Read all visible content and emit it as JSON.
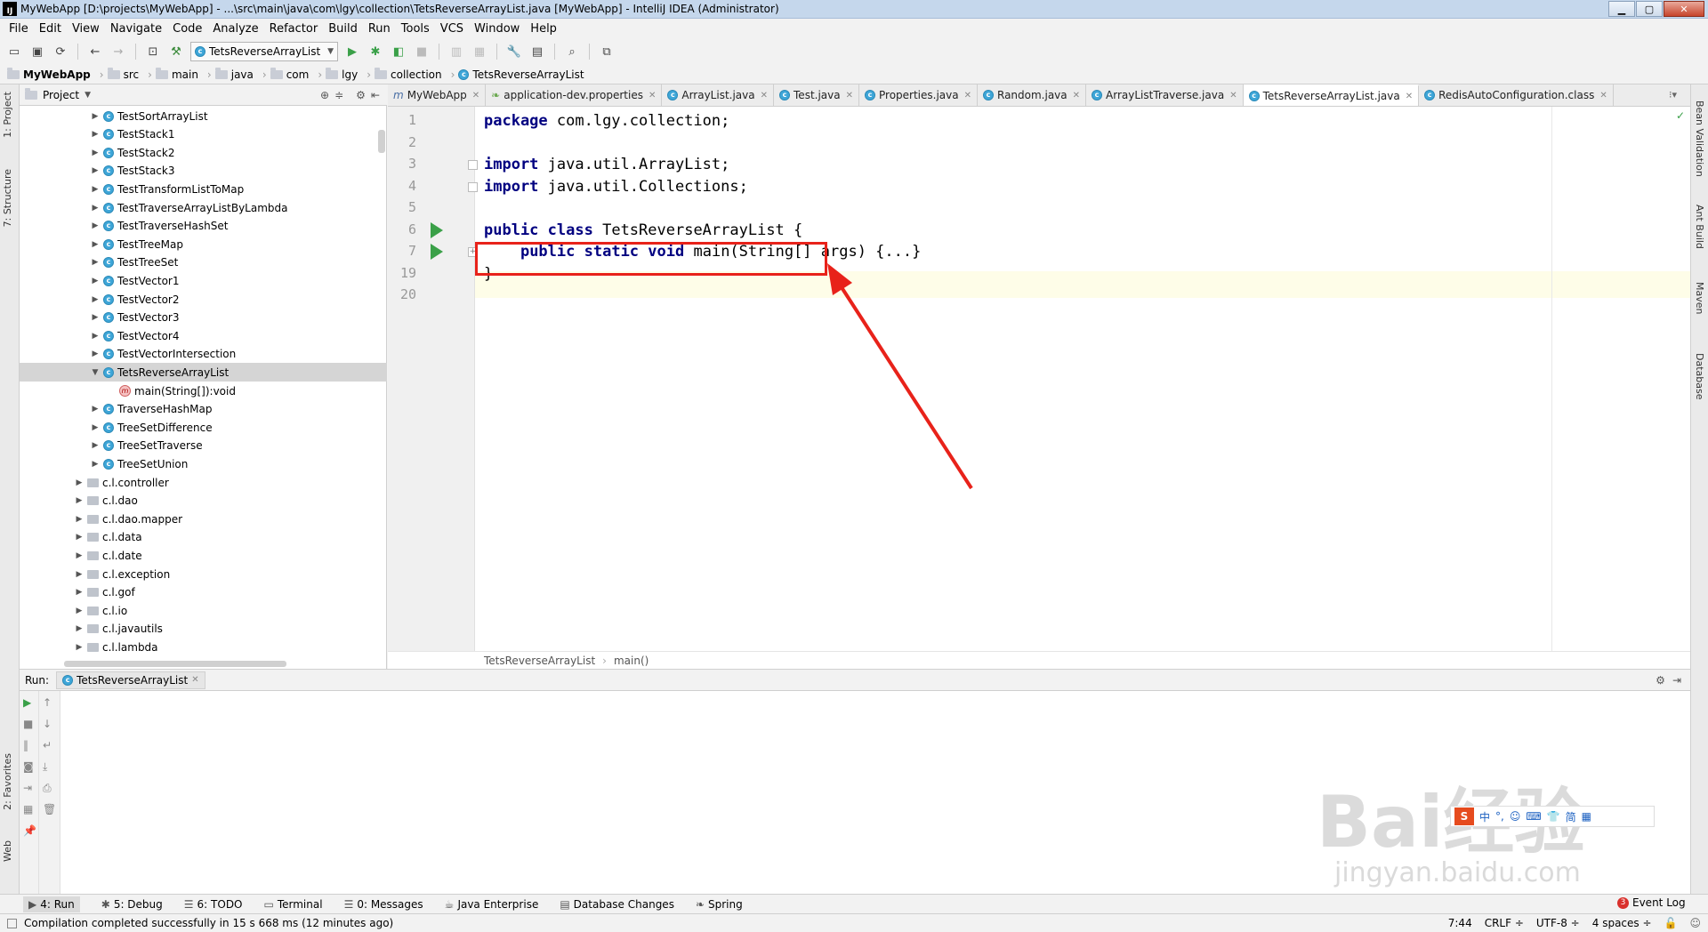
{
  "window": {
    "title": "MyWebApp [D:\\projects\\MyWebApp] - ...\\src\\main\\java\\com\\lgy\\collection\\TetsReverseArrayList.java [MyWebApp] - IntelliJ IDEA (Administrator)",
    "app_icon": "IJ"
  },
  "menu": [
    "File",
    "Edit",
    "View",
    "Navigate",
    "Code",
    "Analyze",
    "Refactor",
    "Build",
    "Run",
    "Tools",
    "VCS",
    "Window",
    "Help"
  ],
  "toolbar": {
    "run_config": "TetsReverseArrayList",
    "icons": [
      "open-icon",
      "save-icon",
      "sync-icon",
      "back-icon",
      "forward-icon",
      "project-structure-icon",
      "build-icon",
      "run-icon",
      "debug-icon",
      "coverage-icon",
      "stop-icon",
      "sdk-icon",
      "structure-icon",
      "settings-icon",
      "vcs-icon",
      "search-icon",
      "plugin-icon"
    ]
  },
  "navbar": {
    "crumbs": [
      "MyWebApp",
      "src",
      "main",
      "java",
      "com",
      "lgy",
      "collection",
      "TetsReverseArrayList"
    ]
  },
  "left_strip": {
    "project_tab": "1: Project",
    "structure_tab": "7: Structure",
    "favorites_tab": "2: Favorites",
    "web_tab": "Web"
  },
  "project": {
    "header": "Project",
    "tree": [
      {
        "label": "TestSortArrayList",
        "type": "class",
        "level": 1,
        "expanded": false
      },
      {
        "label": "TestStack1",
        "type": "class",
        "level": 1,
        "expanded": false
      },
      {
        "label": "TestStack2",
        "type": "class",
        "level": 1,
        "expanded": false
      },
      {
        "label": "TestStack3",
        "type": "class",
        "level": 1,
        "expanded": false
      },
      {
        "label": "TestTransformListToMap",
        "type": "class",
        "level": 1,
        "expanded": false
      },
      {
        "label": "TestTraverseArrayListByLambda",
        "type": "class",
        "level": 1,
        "expanded": false
      },
      {
        "label": "TestTraverseHashSet",
        "type": "class",
        "level": 1,
        "expanded": false
      },
      {
        "label": "TestTreeMap",
        "type": "class",
        "level": 1,
        "expanded": false
      },
      {
        "label": "TestTreeSet",
        "type": "class",
        "level": 1,
        "expanded": false
      },
      {
        "label": "TestVector1",
        "type": "class",
        "level": 1,
        "expanded": false
      },
      {
        "label": "TestVector2",
        "type": "class",
        "level": 1,
        "expanded": false
      },
      {
        "label": "TestVector3",
        "type": "class",
        "level": 1,
        "expanded": false
      },
      {
        "label": "TestVector4",
        "type": "class",
        "level": 1,
        "expanded": false
      },
      {
        "label": "TestVectorIntersection",
        "type": "class",
        "level": 1,
        "expanded": false
      },
      {
        "label": "TetsReverseArrayList",
        "type": "class",
        "level": 1,
        "expanded": true,
        "selected": true
      },
      {
        "label": "main(String[]):void",
        "type": "method",
        "level": 2
      },
      {
        "label": "TraverseHashMap",
        "type": "class",
        "level": 1,
        "expanded": false
      },
      {
        "label": "TreeSetDifference",
        "type": "class",
        "level": 1,
        "expanded": false
      },
      {
        "label": "TreeSetTraverse",
        "type": "class",
        "level": 1,
        "expanded": false
      },
      {
        "label": "TreeSetUnion",
        "type": "class",
        "level": 1,
        "expanded": false
      },
      {
        "label": "c.l.controller",
        "type": "package",
        "level": 0,
        "expanded": false
      },
      {
        "label": "c.l.dao",
        "type": "package",
        "level": 0,
        "expanded": false
      },
      {
        "label": "c.l.dao.mapper",
        "type": "package",
        "level": 0,
        "expanded": false
      },
      {
        "label": "c.l.data",
        "type": "package",
        "level": 0,
        "expanded": false
      },
      {
        "label": "c.l.date",
        "type": "package",
        "level": 0,
        "expanded": false
      },
      {
        "label": "c.l.exception",
        "type": "package",
        "level": 0,
        "expanded": false
      },
      {
        "label": "c.l.gof",
        "type": "package",
        "level": 0,
        "expanded": false
      },
      {
        "label": "c.l.io",
        "type": "package",
        "level": 0,
        "expanded": false
      },
      {
        "label": "c.l.javautils",
        "type": "package",
        "level": 0,
        "expanded": false
      },
      {
        "label": "c.l.lambda",
        "type": "package",
        "level": 0,
        "expanded": false
      }
    ]
  },
  "editor_tabs": [
    {
      "label": "MyWebApp",
      "icon": "m",
      "active": false
    },
    {
      "label": "application-dev.properties",
      "icon": "leaf",
      "active": false
    },
    {
      "label": "ArrayList.java",
      "icon": "c",
      "active": false
    },
    {
      "label": "Test.java",
      "icon": "c",
      "active": false
    },
    {
      "label": "Properties.java",
      "icon": "c",
      "active": false
    },
    {
      "label": "Random.java",
      "icon": "c",
      "active": false
    },
    {
      "label": "ArrayListTraverse.java",
      "icon": "c",
      "active": false
    },
    {
      "label": "TetsReverseArrayList.java",
      "icon": "c",
      "active": true
    },
    {
      "label": "RedisAutoConfiguration.class",
      "icon": "c",
      "active": false
    }
  ],
  "code": {
    "lines": [
      {
        "num": "1",
        "parts": [
          {
            "t": "package",
            "kw": true
          },
          {
            "t": " com.lgy.collection;"
          }
        ]
      },
      {
        "num": "2",
        "parts": []
      },
      {
        "num": "3",
        "parts": [
          {
            "t": "import",
            "kw": true
          },
          {
            "t": " java.util.ArrayList;"
          }
        ]
      },
      {
        "num": "4",
        "parts": [
          {
            "t": "import",
            "kw": true
          },
          {
            "t": " java.util.Collections;"
          }
        ]
      },
      {
        "num": "5",
        "parts": []
      },
      {
        "num": "6",
        "parts": [
          {
            "t": "public",
            "kw": true
          },
          {
            "t": " "
          },
          {
            "t": "class",
            "kw": true
          },
          {
            "t": " TetsReverseArrayList {"
          }
        ],
        "run": true
      },
      {
        "num": "7",
        "parts": [
          {
            "t": "    "
          },
          {
            "t": "public",
            "kw": true
          },
          {
            "t": " "
          },
          {
            "t": "static",
            "kw": true
          },
          {
            "t": " "
          },
          {
            "t": "void",
            "kw": true
          },
          {
            "t": " main(String[] args) {...}"
          }
        ],
        "run": true,
        "current": true
      },
      {
        "num": "19",
        "parts": [
          {
            "t": "}"
          }
        ]
      },
      {
        "num": "20",
        "parts": []
      }
    ],
    "breadcrumb": [
      "TetsReverseArrayList",
      "main()"
    ]
  },
  "right_strip": [
    "Bean Validation",
    "Ant Build",
    "Maven",
    "Database"
  ],
  "run_panel": {
    "label": "Run:",
    "tab": "TetsReverseArrayList"
  },
  "bottom_tabs": [
    {
      "label": "4: Run",
      "active": true
    },
    {
      "label": "5: Debug"
    },
    {
      "label": "6: TODO"
    },
    {
      "label": "Terminal"
    },
    {
      "label": "0: Messages"
    },
    {
      "label": "Java Enterprise"
    },
    {
      "label": "Database Changes"
    },
    {
      "label": "Spring"
    }
  ],
  "event_log": {
    "label": "Event Log",
    "count": "3"
  },
  "status": {
    "message": "Compilation completed successfully in 15 s 668 ms (12 minutes ago)",
    "position": "7:44",
    "line_sep": "CRLF ÷",
    "encoding": "UTF-8 ÷",
    "indent": "4 spaces ÷"
  },
  "watermark": {
    "main": "Bai经验",
    "sub": "jingyan.baidu.com"
  },
  "colors": {
    "keyword": "#000080",
    "annotation": "#e8221a",
    "run_arrow": "#3aa048",
    "class_icon": "#3ea6d8"
  }
}
